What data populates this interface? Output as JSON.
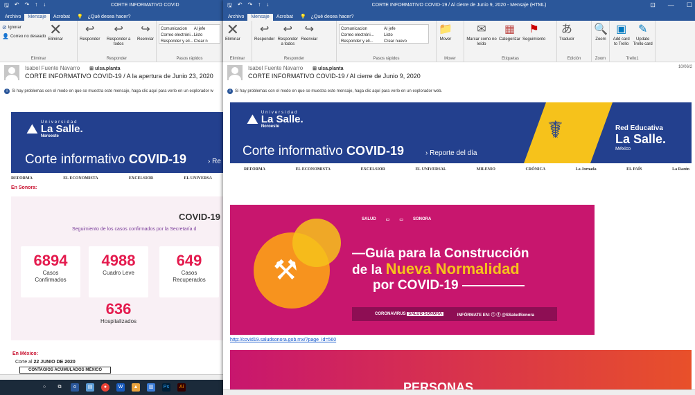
{
  "win1": {
    "title": "CORTE INFORMATIVO COVID",
    "tabs": [
      "Archivo",
      "Mensaje",
      "Acrobat"
    ],
    "tell_me": "¿Qué desea hacer?",
    "ribbon": {
      "ignorar": "Ignorar",
      "correo_no_deseado": "Correo no deseado",
      "eliminar": "Eliminar",
      "responder": "Responder",
      "responder_a_todos": "Responder a todos",
      "reenviar": "Reenviar",
      "qs1": "Comunicacion",
      "qs2": "Al jefe",
      "qs3": "Correo electróni...",
      "qs4": "Listo",
      "qs5": "Responder y eli...",
      "qs6": "Crear n",
      "g_eliminar": "Eliminar",
      "g_responder": "Responder",
      "g_pasos": "Pasos rápidos"
    },
    "sender": "Isabel Fuente Navarro",
    "account": "ulsa.planta",
    "subject": "CORTE INFORMATIVO COVID-19 / A la apertura de Junio 23, 2020",
    "info": "Si hay problemas con el modo en que se muestra este mensaje, haga clic aquí para verlo en un explorador w",
    "banner": {
      "univ": "Universidad",
      "name": "La Salle.",
      "campus": "Noroeste",
      "corte1": "Corte informativo ",
      "corte2": "COVID-19",
      "reporte": "Re"
    },
    "papers": [
      "REFORMA",
      "EL ECONOMISTA",
      "EXCELSIOR",
      "EL UNIVERSA"
    ],
    "sonora": "En Sonora:",
    "covid_title": "COVID-19",
    "covid_sub": "Seguimiento de los casos confirmados por la Secretaría d",
    "stats": [
      {
        "num": "6894",
        "lbl": "Casos Confirmados"
      },
      {
        "num": "4988",
        "lbl": "Cuadro Leve"
      },
      {
        "num": "649",
        "lbl": "Casos Recuperados"
      },
      {
        "num": "636",
        "lbl": "Hospitalizados"
      }
    ],
    "mexico": "En México:",
    "corte_al": "Corte al ",
    "corte_fecha": "22 JUNIO DE 2020",
    "contagios": "CONTAGIOS ACUMULADOS MÉXICO"
  },
  "win2": {
    "title": "CORTE INFORMATIVO COVID-19 / Al cierre de Junio 9, 2020  -  Mensaje (HTML)",
    "tabs": [
      "Archivo",
      "Mensaje",
      "Acrobat"
    ],
    "tell_me": "¿Qué desea hacer?",
    "ribbon": {
      "eliminar": "Eliminar",
      "responder": "Responder",
      "responder_a_todos": "Responder a todos",
      "reenviar": "Reenviar",
      "qs1": "Comunicacion",
      "qs2": "Al jefe",
      "qs3": "Correo electróni...",
      "qs4": "Listo",
      "qs5": "Responder y eli...",
      "qs6": "Crear nuevo",
      "mover": "Mover",
      "marcar": "Marcar como no leído",
      "categorizar": "Categorizar",
      "seguimiento": "Seguimiento",
      "traducir": "Traducir",
      "zoom": "Zoom",
      "addcard": "Add card to Trello",
      "update": "Update Trello card",
      "g_eliminar": "Eliminar",
      "g_responder": "Responder",
      "g_pasos": "Pasos rápidos",
      "g_mover": "Mover",
      "g_etiquetas": "Etiquetas",
      "g_edicion": "Edición",
      "g_zoom": "Zoom",
      "g_trello": "Trello1"
    },
    "sender": "Isabel Fuente Navarro",
    "account": "ulsa.planta",
    "subject": "CORTE INFORMATIVO COVID-19 / Al cierre de Junio 9, 2020",
    "date": "10/06/2",
    "info": "Si hay problemas con el modo en que se muestra este mensaje, haga clic aquí para verlo en un explorador web.",
    "banner": {
      "univ": "Universidad",
      "name": "La Salle.",
      "campus": "Noroeste",
      "corte1": "Corte informativo ",
      "corte2": "COVID-19",
      "reporte": "Reporte del día",
      "red": "Red Educativa",
      "red_name": "La Salle.",
      "red_pais": "México"
    },
    "papers": [
      "REFORMA",
      "EL ECONOMISTA",
      "EXCELSIOR",
      "EL UNIVERSAL",
      "MILENIO",
      "CRÓNICA",
      "La Jornada",
      "EL PAÍS",
      "La Razón"
    ],
    "promo": {
      "salud": "SALUD",
      "sonora": "SONORA",
      "line1": "—Guía para la Construcción",
      "line2a": "de la ",
      "line2b": "Nueva Normalidad",
      "line3": "por COVID-19",
      "coronavirus": "CORONAVIRUS",
      "salud_sonora": "SALUD SONORA",
      "informate": "INFÓRMATE EN:",
      "handle": "@SSaludSonora"
    },
    "link": "http://covid19.saludsonora.gob.mx/?page_id=560",
    "personas": "PERSONAS"
  },
  "colors": {
    "accent": "#2b579a",
    "banner": "#23408e",
    "magenta": "#c8166e",
    "stat": "#e41b4e",
    "yellow": "#f6c21b"
  }
}
